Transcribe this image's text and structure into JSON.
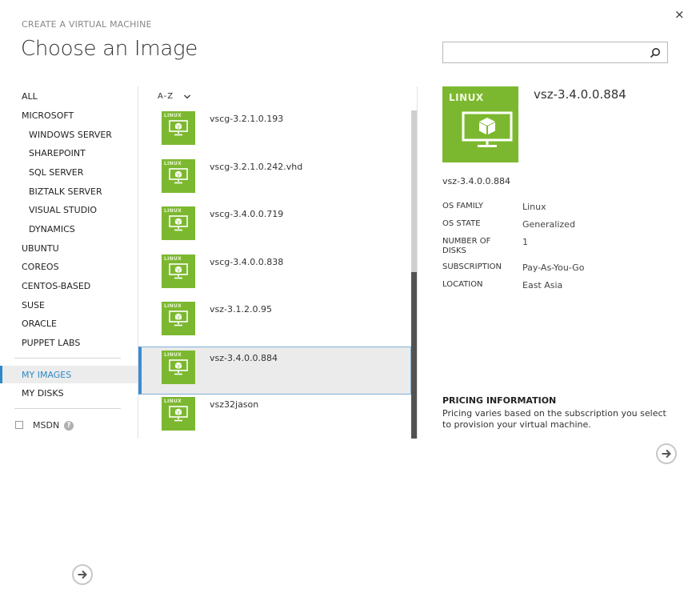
{
  "window": {
    "close_glyph": "×",
    "subtitle": "CREATE A VIRTUAL MACHINE",
    "title": "Choose an Image"
  },
  "search": {
    "value": "",
    "placeholder": ""
  },
  "categories": [
    {
      "label": "ALL",
      "sub": false
    },
    {
      "label": "MICROSOFT",
      "sub": false
    },
    {
      "label": "WINDOWS SERVER",
      "sub": true
    },
    {
      "label": "SHAREPOINT",
      "sub": true
    },
    {
      "label": "SQL SERVER",
      "sub": true
    },
    {
      "label": "BIZTALK SERVER",
      "sub": true
    },
    {
      "label": "VISUAL STUDIO",
      "sub": true
    },
    {
      "label": "DYNAMICS",
      "sub": true
    },
    {
      "label": "UBUNTU",
      "sub": false
    },
    {
      "label": "COREOS",
      "sub": false
    },
    {
      "label": "CENTOS-BASED",
      "sub": false
    },
    {
      "label": "SUSE",
      "sub": false
    },
    {
      "label": "ORACLE",
      "sub": false
    },
    {
      "label": "PUPPET LABS",
      "sub": false
    }
  ],
  "my_categories": [
    {
      "label": "MY IMAGES",
      "selected": true
    },
    {
      "label": "MY DISKS",
      "selected": false
    }
  ],
  "msdn": {
    "label": "MSDN",
    "checked": false,
    "help_glyph": "?"
  },
  "sort": {
    "label": "A-Z"
  },
  "images": [
    {
      "os": "LINUX",
      "name": "vscg-3.2.1.0.193",
      "selected": false
    },
    {
      "os": "LINUX",
      "name": "vscg-3.2.1.0.242.vhd",
      "selected": false
    },
    {
      "os": "LINUX",
      "name": "vscg-3.4.0.0.719",
      "selected": false
    },
    {
      "os": "LINUX",
      "name": "vscg-3.4.0.0.838",
      "selected": false
    },
    {
      "os": "LINUX",
      "name": "vsz-3.1.2.0.95",
      "selected": false
    },
    {
      "os": "LINUX",
      "name": "vsz-3.4.0.0.884",
      "selected": true
    },
    {
      "os": "LINUX",
      "name": "vsz32jason",
      "selected": false
    }
  ],
  "detail": {
    "os": "LINUX",
    "title": "vsz-3.4.0.0.884",
    "name": "vsz-3.4.0.0.884",
    "properties": [
      {
        "label": "OS FAMILY",
        "value": "Linux"
      },
      {
        "label": "OS STATE",
        "value": "Generalized"
      },
      {
        "label": "NUMBER OF DISKS",
        "value": "1"
      },
      {
        "label": "SUBSCRIPTION",
        "value": "Pay-As-You-Go"
      },
      {
        "label": "LOCATION",
        "value": "East Asia"
      }
    ],
    "pricing_title": "PRICING INFORMATION",
    "pricing_text": "Pricing varies based on the subscription you select to provision your virtual machine."
  },
  "colors": {
    "linux_green": "#7cb82f",
    "accent_blue": "#2d89c7",
    "selected_bg": "#ebebeb"
  }
}
